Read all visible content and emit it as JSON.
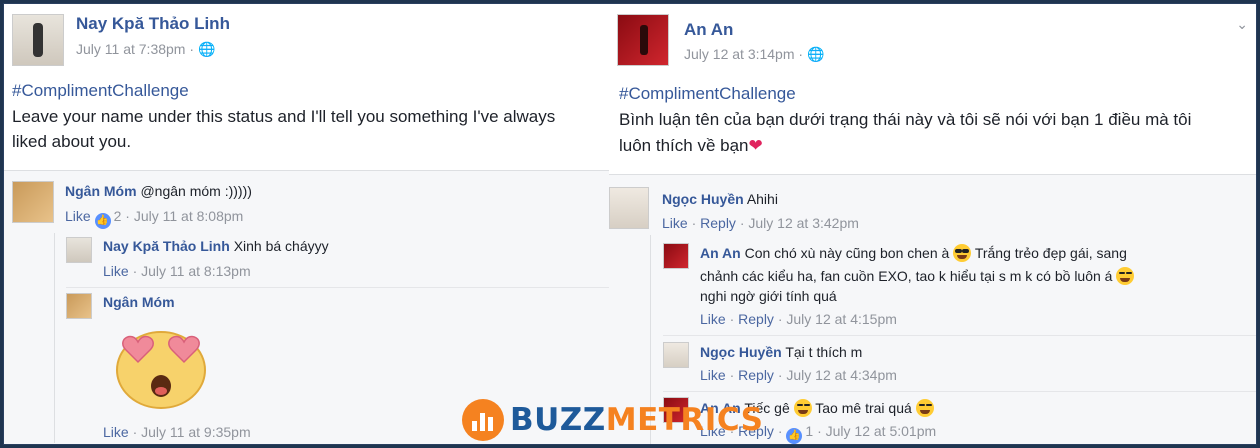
{
  "left_post": {
    "author": "Nay Kpă Thảo Linh",
    "timestamp": "July 11 at 7:38pm",
    "hashtag": "#ComplimentChallenge",
    "text_line1": "Leave your name under this status and I'll tell you something I've always",
    "text_line2": "liked about you.",
    "comments": [
      {
        "name": "Ngân Móm",
        "text": "@ngân móm :)))))",
        "like": "Like",
        "likes": "2",
        "time": "July 11 at 8:08pm"
      },
      {
        "name": "Nay Kpă Thảo Linh",
        "text": "Xinh bá cháyyy",
        "like": "Like",
        "time": "July 11 at 8:13pm"
      },
      {
        "name": "Ngân Móm",
        "text": "",
        "like": "Like",
        "time": "July 11 at 9:35pm"
      }
    ]
  },
  "right_post": {
    "author": "An An",
    "timestamp": "July 12 at 3:14pm",
    "hashtag": "#ComplimentChallenge",
    "text_line1": "Bình luận tên của bạn dưới trạng thái này và tôi sẽ nói với bạn 1 điều mà tôi",
    "text_line2": "luôn thích về bạn",
    "comments": [
      {
        "name": "Ngọc Huyền",
        "text": "Ahihi",
        "like": "Like",
        "reply": "Reply",
        "time": "July 12 at 3:42pm"
      },
      {
        "name": "An An",
        "text1": "Con chó xù này cũng bon chen à",
        "text1b": "Trắng trẻo đẹp gái, sang",
        "text2": "chảnh các kiểu ha, fan cuồn EXO, tao k hiểu tại s m k có bồ luôn á",
        "text3": "nghi ngờ giới tính quá",
        "like": "Like",
        "reply": "Reply",
        "time": "July 12 at 4:15pm"
      },
      {
        "name": "Ngọc Huyền",
        "text": "Tại t thích m",
        "like": "Like",
        "reply": "Reply",
        "time": "July 12 at 4:34pm"
      },
      {
        "name": "An An",
        "text1": "Tiếc gê",
        "text1b": "Tao mê trai quá",
        "like": "Like",
        "reply": "Reply",
        "likes": "1",
        "time": "July 12 at 5:01pm"
      }
    ]
  },
  "watermark": {
    "part1": "BUZZ",
    "part2": "METRICS"
  },
  "colors": {
    "link": "#365899",
    "meta": "#90949c",
    "like_blue": "#5890ff",
    "brand_orange": "#f58220",
    "brand_blue": "#1e5a9a"
  },
  "icons": [
    "globe-icon",
    "chevron-down-icon",
    "like-badge-icon",
    "heart-icon",
    "sunglasses-emoji-icon",
    "laughing-emoji-icon",
    "heart-eyes-sticker",
    "buzzmetrics-logo-icon"
  ]
}
